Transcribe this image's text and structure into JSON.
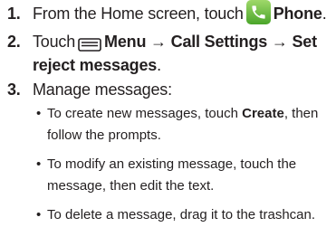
{
  "steps": [
    {
      "number": "1.",
      "text_before": "From the Home screen, touch",
      "icon": "phone-app-icon",
      "bold": "Phone",
      "text_after": "."
    },
    {
      "number": "2.",
      "text_before": "Touch",
      "icon": "menu-key-icon",
      "bold_line1": "Menu → Call Settings → Set",
      "bold_line2": "reject messages",
      "text_after": "."
    },
    {
      "number": "3.",
      "text": "Manage messages:"
    }
  ],
  "bullets": [
    {
      "line1_before": "To create new messages, touch ",
      "line1_bold": "Create",
      "line1_after": ", then",
      "line2": "follow the prompts."
    },
    {
      "line1": "To modify an existing message, touch the",
      "line2": "message, then edit the text."
    },
    {
      "line1": "To delete a message, drag it to the trashcan."
    }
  ],
  "colors": {
    "text": "#231f20",
    "phone_icon_bg": "#5bb032"
  }
}
